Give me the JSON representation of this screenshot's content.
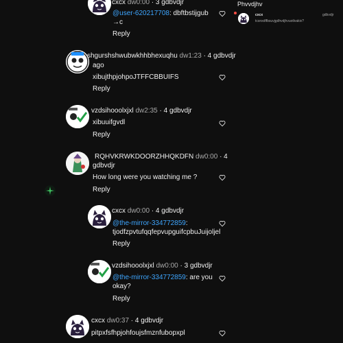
{
  "comments": [
    {
      "name": "cxcx",
      "time": "dw0:00",
      "meta": " · 3 gdbvdjr",
      "mention": "@user-620217708",
      "text": ": dbftbstijgub →c",
      "reply": "Reply"
    },
    {
      "name": "shgurshshwubwkhhbhexuqhu",
      "time": "dw1:23",
      "meta": " · 4 gdbvdjr",
      "meta2": "ago",
      "text": "xibujthpjohpoJTFFCBBUIFS",
      "reply": "Reply"
    },
    {
      "name": "vzdsihooolxjxl",
      "time": "dw2:35",
      "meta": " · 4 gdbvdjr",
      "text": "xibuuifgvdl",
      "reply": "Reply"
    },
    {
      "name": "RQHVKRWKDOORZHHQKDFN",
      "time": "dw0:00",
      "meta": " · 4",
      "meta2": "gdbvdjr",
      "text": "How long were you watching me ?",
      "reply": "Reply"
    },
    {
      "name": "cxcx",
      "time": "dw0:00",
      "meta": " · 4 gdbvdjr",
      "mention": "@the-mirror-334772859",
      "text": ":",
      "text2": "tjodfzpvtufqqfepvupguifcpbuJuijoljel",
      "reply": "Reply"
    },
    {
      "name": "vzdsihooolxjxl",
      "time": "dw0:00",
      "meta": " · 3 gdbvdjr",
      "mention": "@the-mirror-334772859",
      "text": ": are you",
      "text2": "okay?",
      "reply": "Reply"
    },
    {
      "name": "cxcx",
      "time": "dw0:37",
      "meta": " · 4 gdbvdjr",
      "text": "pitpxfsfhpjohfoujsfmznfubopxpl"
    }
  ],
  "side": {
    "title": "Phvvdjhv",
    "notif_name": "cxcx",
    "notif_handle": "gdbvdjr",
    "notif_text": "tcsnxdffbsuvjgdhvdjhvuotlvakiv?"
  }
}
